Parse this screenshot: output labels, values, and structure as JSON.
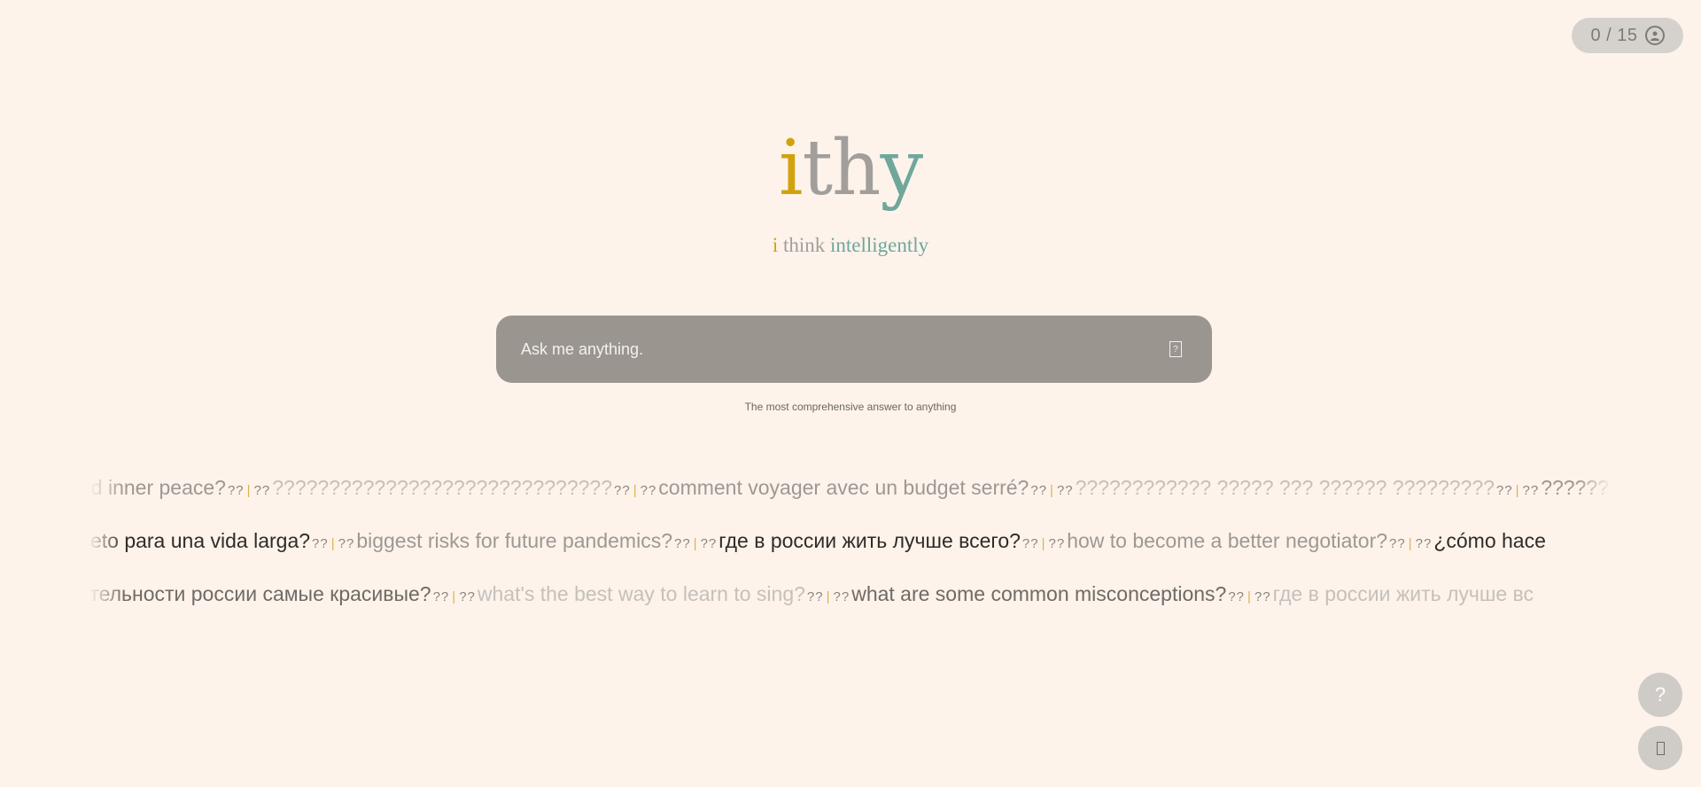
{
  "usage": {
    "counter": "0 / 15",
    "icon": "account-icon"
  },
  "logo": {
    "i": "i",
    "th": "th",
    "y": "y"
  },
  "tagline": {
    "i": "i",
    "think": "think",
    "intelligently": "intelligently"
  },
  "search": {
    "placeholder": "Ask me anything.",
    "send_icon": "send-icon",
    "caption": "The most comprehensive answer to anything"
  },
  "examples": {
    "row1": [
      "nd inner peace?",
      "??????????????????????????????",
      "comment voyager avec un budget serré?",
      "???????????? ????? ??? ?????? ?????????",
      "???????? ??????? ????? ????",
      "????????????"
    ],
    "row2": [
      "ecreto para una vida larga?",
      "biggest risks for future pandemics?",
      "где в россии жить лучше всего?",
      "how to become a better negotiator?",
      "¿cómo hace"
    ],
    "row3": [
      "ечательности россии самые красивые?",
      "what's the best way to learn to sing?",
      "what are some common misconceptions?",
      "где в россии жить лучше вс"
    ],
    "separator": "??|??"
  },
  "floating": {
    "help_label": "?",
    "help_icon": "question-icon",
    "second_icon": "chat-icon"
  },
  "colors": {
    "background": "#fdf3eb",
    "gold": "#d1a20d",
    "grey": "#a19e9b",
    "teal": "#6fa79b",
    "search_bg": "#9a958f"
  }
}
